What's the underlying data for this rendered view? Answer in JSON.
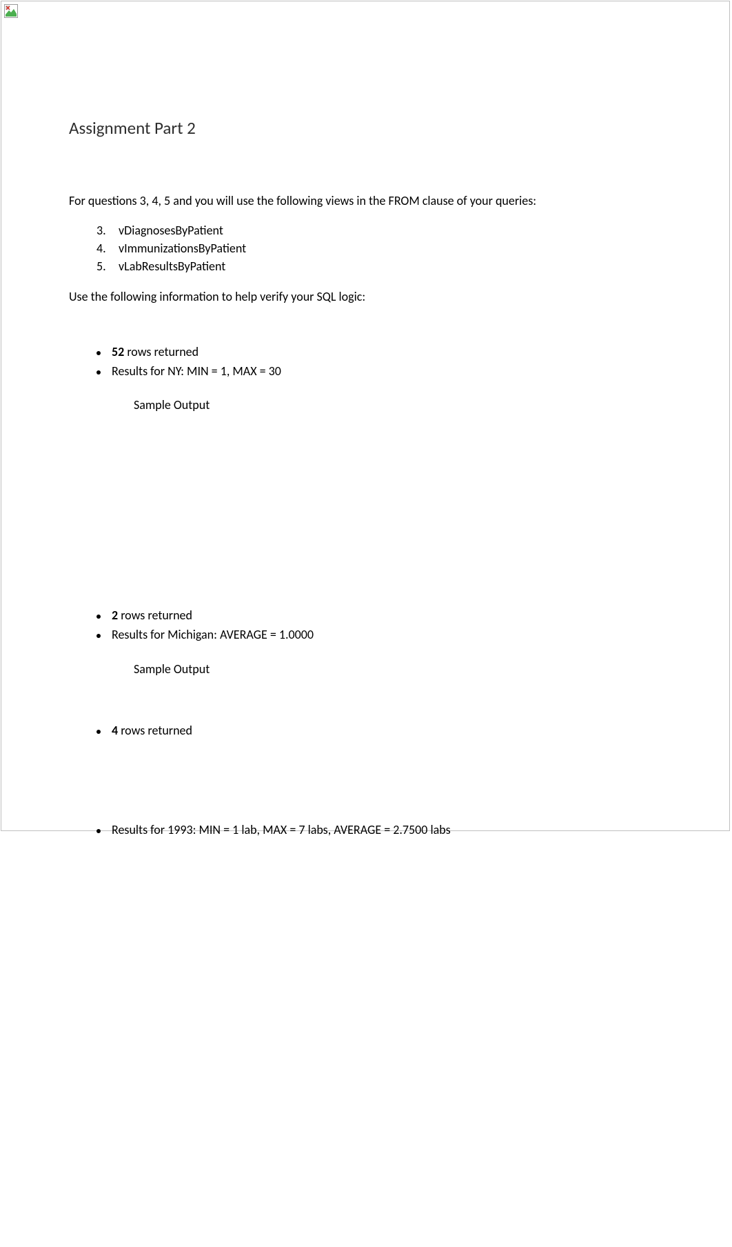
{
  "title": "Assignment Part 2",
  "intro": "For questions 3, 4, 5 and you will use the following views in the FROM clause of your queries:",
  "views": [
    {
      "num": "3.",
      "name": "vDiagnosesByPatient"
    },
    {
      "num": "4.",
      "name": "vImmunizationsByPatient"
    },
    {
      "num": "5.",
      "name": "vLabResultsByPatient"
    }
  ],
  "verify_intro": "Use the following information to help verify your SQL logic:",
  "block1": {
    "rows_bold": "52",
    "rows_text": " rows returned",
    "detail": "Results for NY: MIN = 1, MAX = 30",
    "sample_label": "Sample Output"
  },
  "block2": {
    "rows_bold": "2",
    "rows_text": " rows returned",
    "detail": "Results for Michigan:  AVERAGE = 1.0000",
    "sample_label": "Sample Output"
  },
  "block3": {
    "rows_bold": "4",
    "rows_text": " rows returned"
  },
  "block4": {
    "detail": "Results for 1993: MIN = 1 lab, MAX = 7 labs, AVERAGE = 2.7500 labs"
  }
}
